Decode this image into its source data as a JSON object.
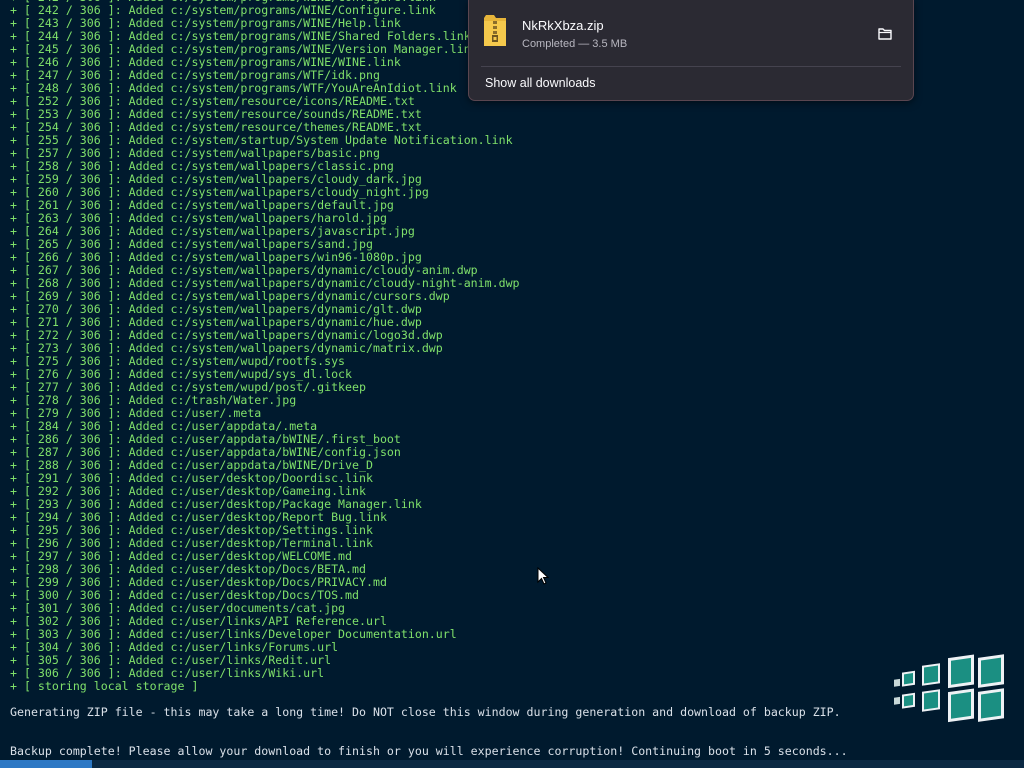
{
  "terminal": {
    "lines": [
      "+ [ 242 / 306 ]: Added c:/system/programs/WINE/Configure.link",
      "+ [ 242 / 306 ]: Added c:/system/programs/WINE/Configure.link",
      "+ [ 243 / 306 ]: Added c:/system/programs/WINE/Help.link",
      "+ [ 244 / 306 ]: Added c:/system/programs/WINE/Shared Folders.link",
      "+ [ 245 / 306 ]: Added c:/system/programs/WINE/Version Manager.link",
      "+ [ 246 / 306 ]: Added c:/system/programs/WINE/WINE.link",
      "+ [ 247 / 306 ]: Added c:/system/programs/WTF/idk.png",
      "+ [ 248 / 306 ]: Added c:/system/programs/WTF/YouAreAnIdiot.link",
      "+ [ 252 / 306 ]: Added c:/system/resource/icons/README.txt",
      "+ [ 253 / 306 ]: Added c:/system/resource/sounds/README.txt",
      "+ [ 254 / 306 ]: Added c:/system/resource/themes/README.txt",
      "+ [ 255 / 306 ]: Added c:/system/startup/System Update Notification.link",
      "+ [ 257 / 306 ]: Added c:/system/wallpapers/basic.png",
      "+ [ 258 / 306 ]: Added c:/system/wallpapers/classic.png",
      "+ [ 259 / 306 ]: Added c:/system/wallpapers/cloudy_dark.jpg",
      "+ [ 260 / 306 ]: Added c:/system/wallpapers/cloudy_night.jpg",
      "+ [ 261 / 306 ]: Added c:/system/wallpapers/default.jpg",
      "+ [ 263 / 306 ]: Added c:/system/wallpapers/harold.jpg",
      "+ [ 264 / 306 ]: Added c:/system/wallpapers/javascript.jpg",
      "+ [ 265 / 306 ]: Added c:/system/wallpapers/sand.jpg",
      "+ [ 266 / 306 ]: Added c:/system/wallpapers/win96-1080p.jpg",
      "+ [ 267 / 306 ]: Added c:/system/wallpapers/dynamic/cloudy-anim.dwp",
      "+ [ 268 / 306 ]: Added c:/system/wallpapers/dynamic/cloudy-night-anim.dwp",
      "+ [ 269 / 306 ]: Added c:/system/wallpapers/dynamic/cursors.dwp",
      "+ [ 270 / 306 ]: Added c:/system/wallpapers/dynamic/glt.dwp",
      "+ [ 271 / 306 ]: Added c:/system/wallpapers/dynamic/hue.dwp",
      "+ [ 272 / 306 ]: Added c:/system/wallpapers/dynamic/logo3d.dwp",
      "+ [ 273 / 306 ]: Added c:/system/wallpapers/dynamic/matrix.dwp",
      "+ [ 275 / 306 ]: Added c:/system/wupd/rootfs.sys",
      "+ [ 276 / 306 ]: Added c:/system/wupd/sys_dl.lock",
      "+ [ 277 / 306 ]: Added c:/system/wupd/post/.gitkeep",
      "+ [ 278 / 306 ]: Added c:/trash/Water.jpg",
      "+ [ 279 / 306 ]: Added c:/user/.meta",
      "+ [ 284 / 306 ]: Added c:/user/appdata/.meta",
      "+ [ 286 / 306 ]: Added c:/user/appdata/bWINE/.first_boot",
      "+ [ 287 / 306 ]: Added c:/user/appdata/bWINE/config.json",
      "+ [ 288 / 306 ]: Added c:/user/appdata/bWINE/Drive_D",
      "+ [ 291 / 306 ]: Added c:/user/desktop/Doordisc.link",
      "+ [ 292 / 306 ]: Added c:/user/desktop/Gameing.link",
      "+ [ 293 / 306 ]: Added c:/user/desktop/Package Manager.link",
      "+ [ 294 / 306 ]: Added c:/user/desktop/Report Bug.link",
      "+ [ 295 / 306 ]: Added c:/user/desktop/Settings.link",
      "+ [ 296 / 306 ]: Added c:/user/desktop/Terminal.link",
      "+ [ 297 / 306 ]: Added c:/user/desktop/WELCOME.md",
      "+ [ 298 / 306 ]: Added c:/user/desktop/Docs/BETA.md",
      "+ [ 299 / 306 ]: Added c:/user/desktop/Docs/PRIVACY.md",
      "+ [ 300 / 306 ]: Added c:/user/desktop/Docs/TOS.md",
      "+ [ 301 / 306 ]: Added c:/user/documents/cat.jpg",
      "+ [ 302 / 306 ]: Added c:/user/links/API Reference.url",
      "+ [ 303 / 306 ]: Added c:/user/links/Developer Documentation.url",
      "+ [ 304 / 306 ]: Added c:/user/links/Forums.url",
      "+ [ 305 / 306 ]: Added c:/user/links/Redit.url",
      "+ [ 306 / 306 ]: Added c:/user/links/Wiki.url",
      "+ [ storing local storage ]"
    ],
    "zip_message": "Generating ZIP file - this may take a long time! Do NOT close this window during generation and download of backup ZIP.",
    "backup_message": "Backup complete! Please allow your download to finish or you will experience corruption! Continuing boot in 5 seconds...",
    "boot_progress_percent": 9
  },
  "downloads_panel": {
    "filename": "NkRkXbza.zip",
    "status": "Completed — 3.5 MB",
    "show_all_label": "Show all downloads",
    "icons": {
      "file": "zip-archive-icon",
      "action": "folder-icon"
    }
  },
  "colors": {
    "background": "#001a2e",
    "log_text": "#7fe06a",
    "message_text": "#d9e0e8",
    "progress": "#2d78c4",
    "popup_bg": "#2b2a33"
  }
}
